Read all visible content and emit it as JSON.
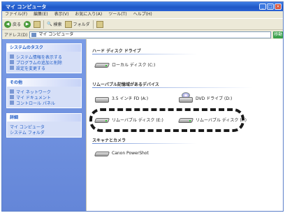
{
  "window": {
    "title": "マイ コンピュータ",
    "controls": [
      "_",
      "□",
      "×"
    ]
  },
  "menu": [
    "ファイル(F)",
    "編集(E)",
    "表示(V)",
    "お気に入り(A)",
    "ツール(T)",
    "ヘルプ(H)"
  ],
  "toolbar": {
    "back_label": "戻る",
    "forward_label": "",
    "up_label": "",
    "search_label": "検索",
    "folders_label": "フォルダ"
  },
  "address": {
    "label": "アドレス(D)",
    "value": "マイ コンピュータ",
    "go_label": "移動"
  },
  "sidebar": {
    "tasks": {
      "title": "システムのタスク",
      "items": [
        "システム情報を表示する",
        "プログラムの追加と削除",
        "設定を変更する"
      ]
    },
    "places": {
      "title": "その他",
      "items": [
        "マイ ネットワーク",
        "マイ ドキュメント",
        "コントロール パネル"
      ]
    },
    "details": {
      "title": "詳細",
      "items": [
        "マイ コンピュータ",
        "システム フォルダ"
      ]
    }
  },
  "content": {
    "section1": {
      "title": "ハード ディスク ドライブ",
      "items": [
        "ローカル ディスク (C:)"
      ]
    },
    "section2": {
      "title": "リムーバブル記憶域があるデバイス",
      "items": [
        "3.5 インチ FD (A:)",
        "DVD ドライブ (D:)",
        "リムーバブル ディスク (E:)",
        "リムーバブル ディスク (F:)"
      ]
    },
    "section3": {
      "title": "スキャナとカメラ",
      "items": [
        "Canon PowerShot"
      ]
    }
  }
}
